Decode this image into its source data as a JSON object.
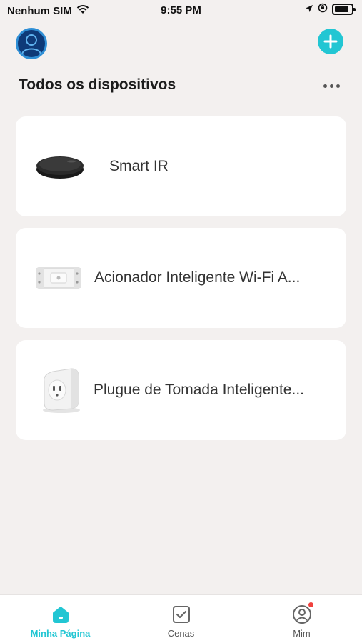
{
  "status_bar": {
    "carrier": "Nenhum SIM",
    "time": "9:55 PM"
  },
  "header": {
    "title": "Todos os dispositivos"
  },
  "devices": [
    {
      "name": "Smart IR",
      "icon": "ir-hub-icon"
    },
    {
      "name": "Acionador Inteligente Wi-Fi A...",
      "icon": "relay-switch-icon"
    },
    {
      "name": "Plugue de Tomada Inteligente...",
      "icon": "smart-plug-icon"
    }
  ],
  "tab_bar": {
    "tabs": [
      {
        "label": "Minha Página",
        "icon": "home-icon",
        "active": true
      },
      {
        "label": "Cenas",
        "icon": "scenes-icon",
        "active": false
      },
      {
        "label": "Mim",
        "icon": "profile-icon",
        "active": false
      }
    ]
  },
  "colors": {
    "accent": "#22c6d3",
    "background": "#f3f0ef",
    "notification": "#f0413e"
  }
}
